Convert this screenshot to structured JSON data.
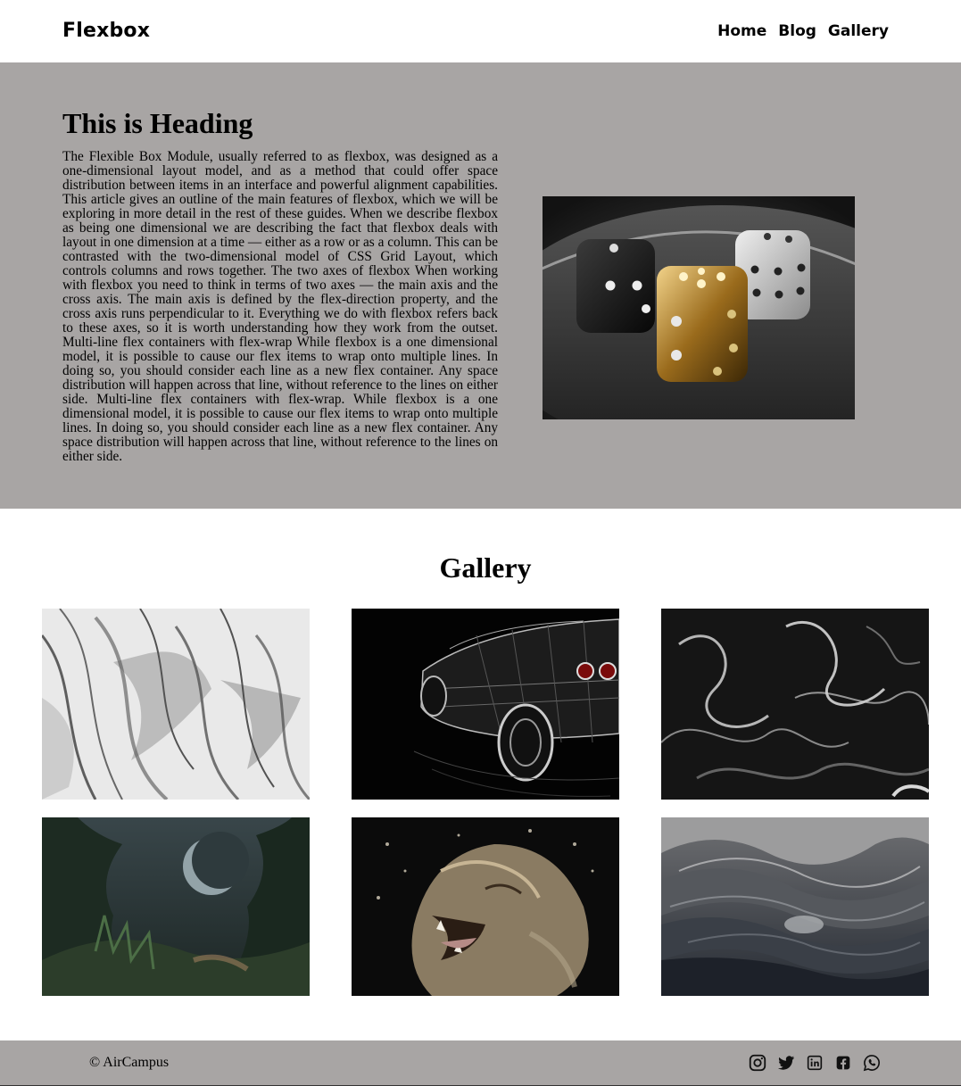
{
  "header": {
    "brand": "Flexbox",
    "nav": [
      {
        "label": "Home"
      },
      {
        "label": "Blog"
      },
      {
        "label": "Gallery"
      }
    ]
  },
  "hero": {
    "heading": "This is Heading",
    "paragraph": "The Flexible Box Module, usually referred to as flexbox, was designed as a one-dimensional layout model, and as a method that could offer space distribution between items in an interface and powerful alignment capabilities. This article gives an outline of the main features of flexbox, which we will be exploring in more detail in the rest of these guides. When we describe flexbox as being one dimensional we are describing the fact that flexbox deals with layout in one dimension at a time — either as a row or as a column. This can be contrasted with the two-dimensional model of CSS Grid Layout, which controls columns and rows together. The two axes of flexbox When working with flexbox you need to think in terms of two axes — the main axis and the cross axis. The main axis is defined by the flex-direction property, and the cross axis runs perpendicular to it. Everything we do with flexbox refers back to these axes, so it is worth understanding how they work from the outset. Multi-line flex containers with flex-wrap While flexbox is a one dimensional model, it is possible to cause our flex items to wrap onto multiple lines. In doing so, you should consider each line as a new flex container. Any space distribution will happen across that line, without reference to the lines on either side. Multi-line flex containers with flex-wrap. While flexbox is a one dimensional model, it is possible to cause our flex items to wrap onto multiple lines. In doing so, you should consider each line as a new flex container. Any space distribution will happen across that line, without reference to the lines on either side."
  },
  "gallery": {
    "title": "Gallery"
  },
  "footer": {
    "copyright": "© AirCampus",
    "socials": [
      "instagram-icon",
      "twitter-icon",
      "linkedin-icon",
      "facebook-icon",
      "whatsapp-icon"
    ]
  },
  "colors": {
    "hero_background": "#a8a5a4",
    "footer_background": "#a8a5a4",
    "page_background": "#ffffff",
    "text": "#000000"
  }
}
